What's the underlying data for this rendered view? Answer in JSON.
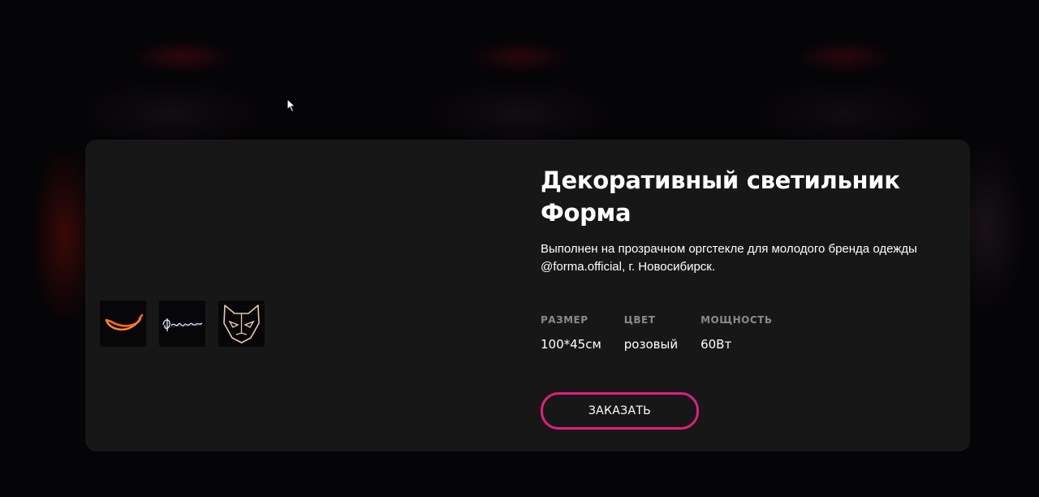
{
  "product": {
    "title": "Декоративный светильник Форма",
    "description": "Выполнен на прозрачном оргстекле для молодого бренда одежды @forma.official, г. Новосибирск.",
    "specs": [
      {
        "label": "РАЗМЕР",
        "value": "100*45см"
      },
      {
        "label": "ЦВЕТ",
        "value": "розовый"
      },
      {
        "label": "МОЩНОСТЬ",
        "value": "60Вт"
      }
    ],
    "order_label": "ЗАКАЗАТЬ"
  },
  "thumbnails": [
    {
      "icon": "neon-banana-icon"
    },
    {
      "icon": "neon-forma-script-icon"
    },
    {
      "icon": "neon-cat-face-icon"
    }
  ],
  "colors": {
    "card_bg": "#171717",
    "accent": "#e01f7e",
    "text": "#ffffff",
    "muted": "#8a8a8a"
  }
}
